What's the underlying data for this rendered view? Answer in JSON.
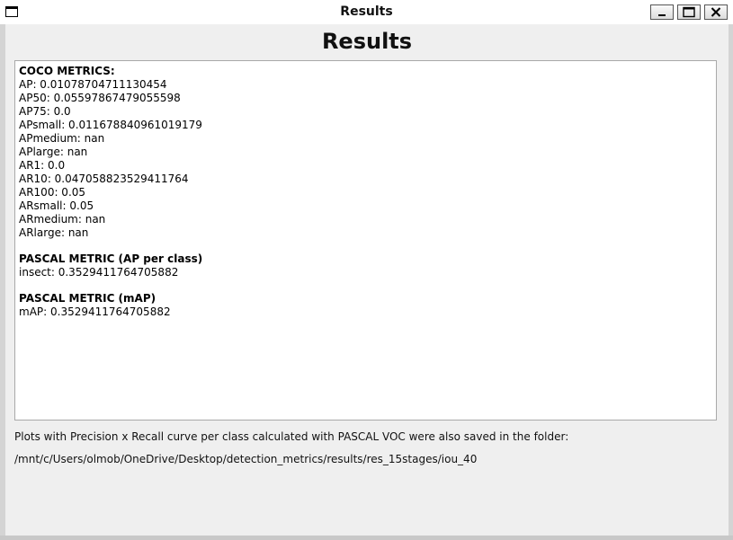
{
  "window": {
    "title": "Results"
  },
  "main": {
    "heading": "Results",
    "coco": {
      "header": "COCO METRICS:",
      "lines": [
        "AP: 0.01078704711130454",
        "AP50: 0.05597867479055598",
        "AP75: 0.0",
        "APsmall: 0.011678840961019179",
        "APmedium: nan",
        "APlarge: nan",
        "AR1: 0.0",
        "AR10: 0.047058823529411764",
        "AR100: 0.05",
        "ARsmall: 0.05",
        "ARmedium: nan",
        "ARlarge: nan"
      ]
    },
    "pascal_per_class": {
      "header": "PASCAL METRIC (AP per class)",
      "lines": [
        "insect: 0.3529411764705882"
      ]
    },
    "pascal_map": {
      "header": "PASCAL METRIC (mAP)",
      "lines": [
        "mAP: 0.3529411764705882"
      ]
    },
    "info_line": "Plots with Precision x Recall  curve per class calculated with PASCAL VOC were also saved in the folder:",
    "folder_path": "/mnt/c/Users/olmob/OneDrive/Desktop/detection_metrics/results/res_15stages/iou_40"
  },
  "icons": {
    "app": "window-icon",
    "minimize": "minimize-icon",
    "maximize": "maximize-icon",
    "close": "close-icon"
  }
}
